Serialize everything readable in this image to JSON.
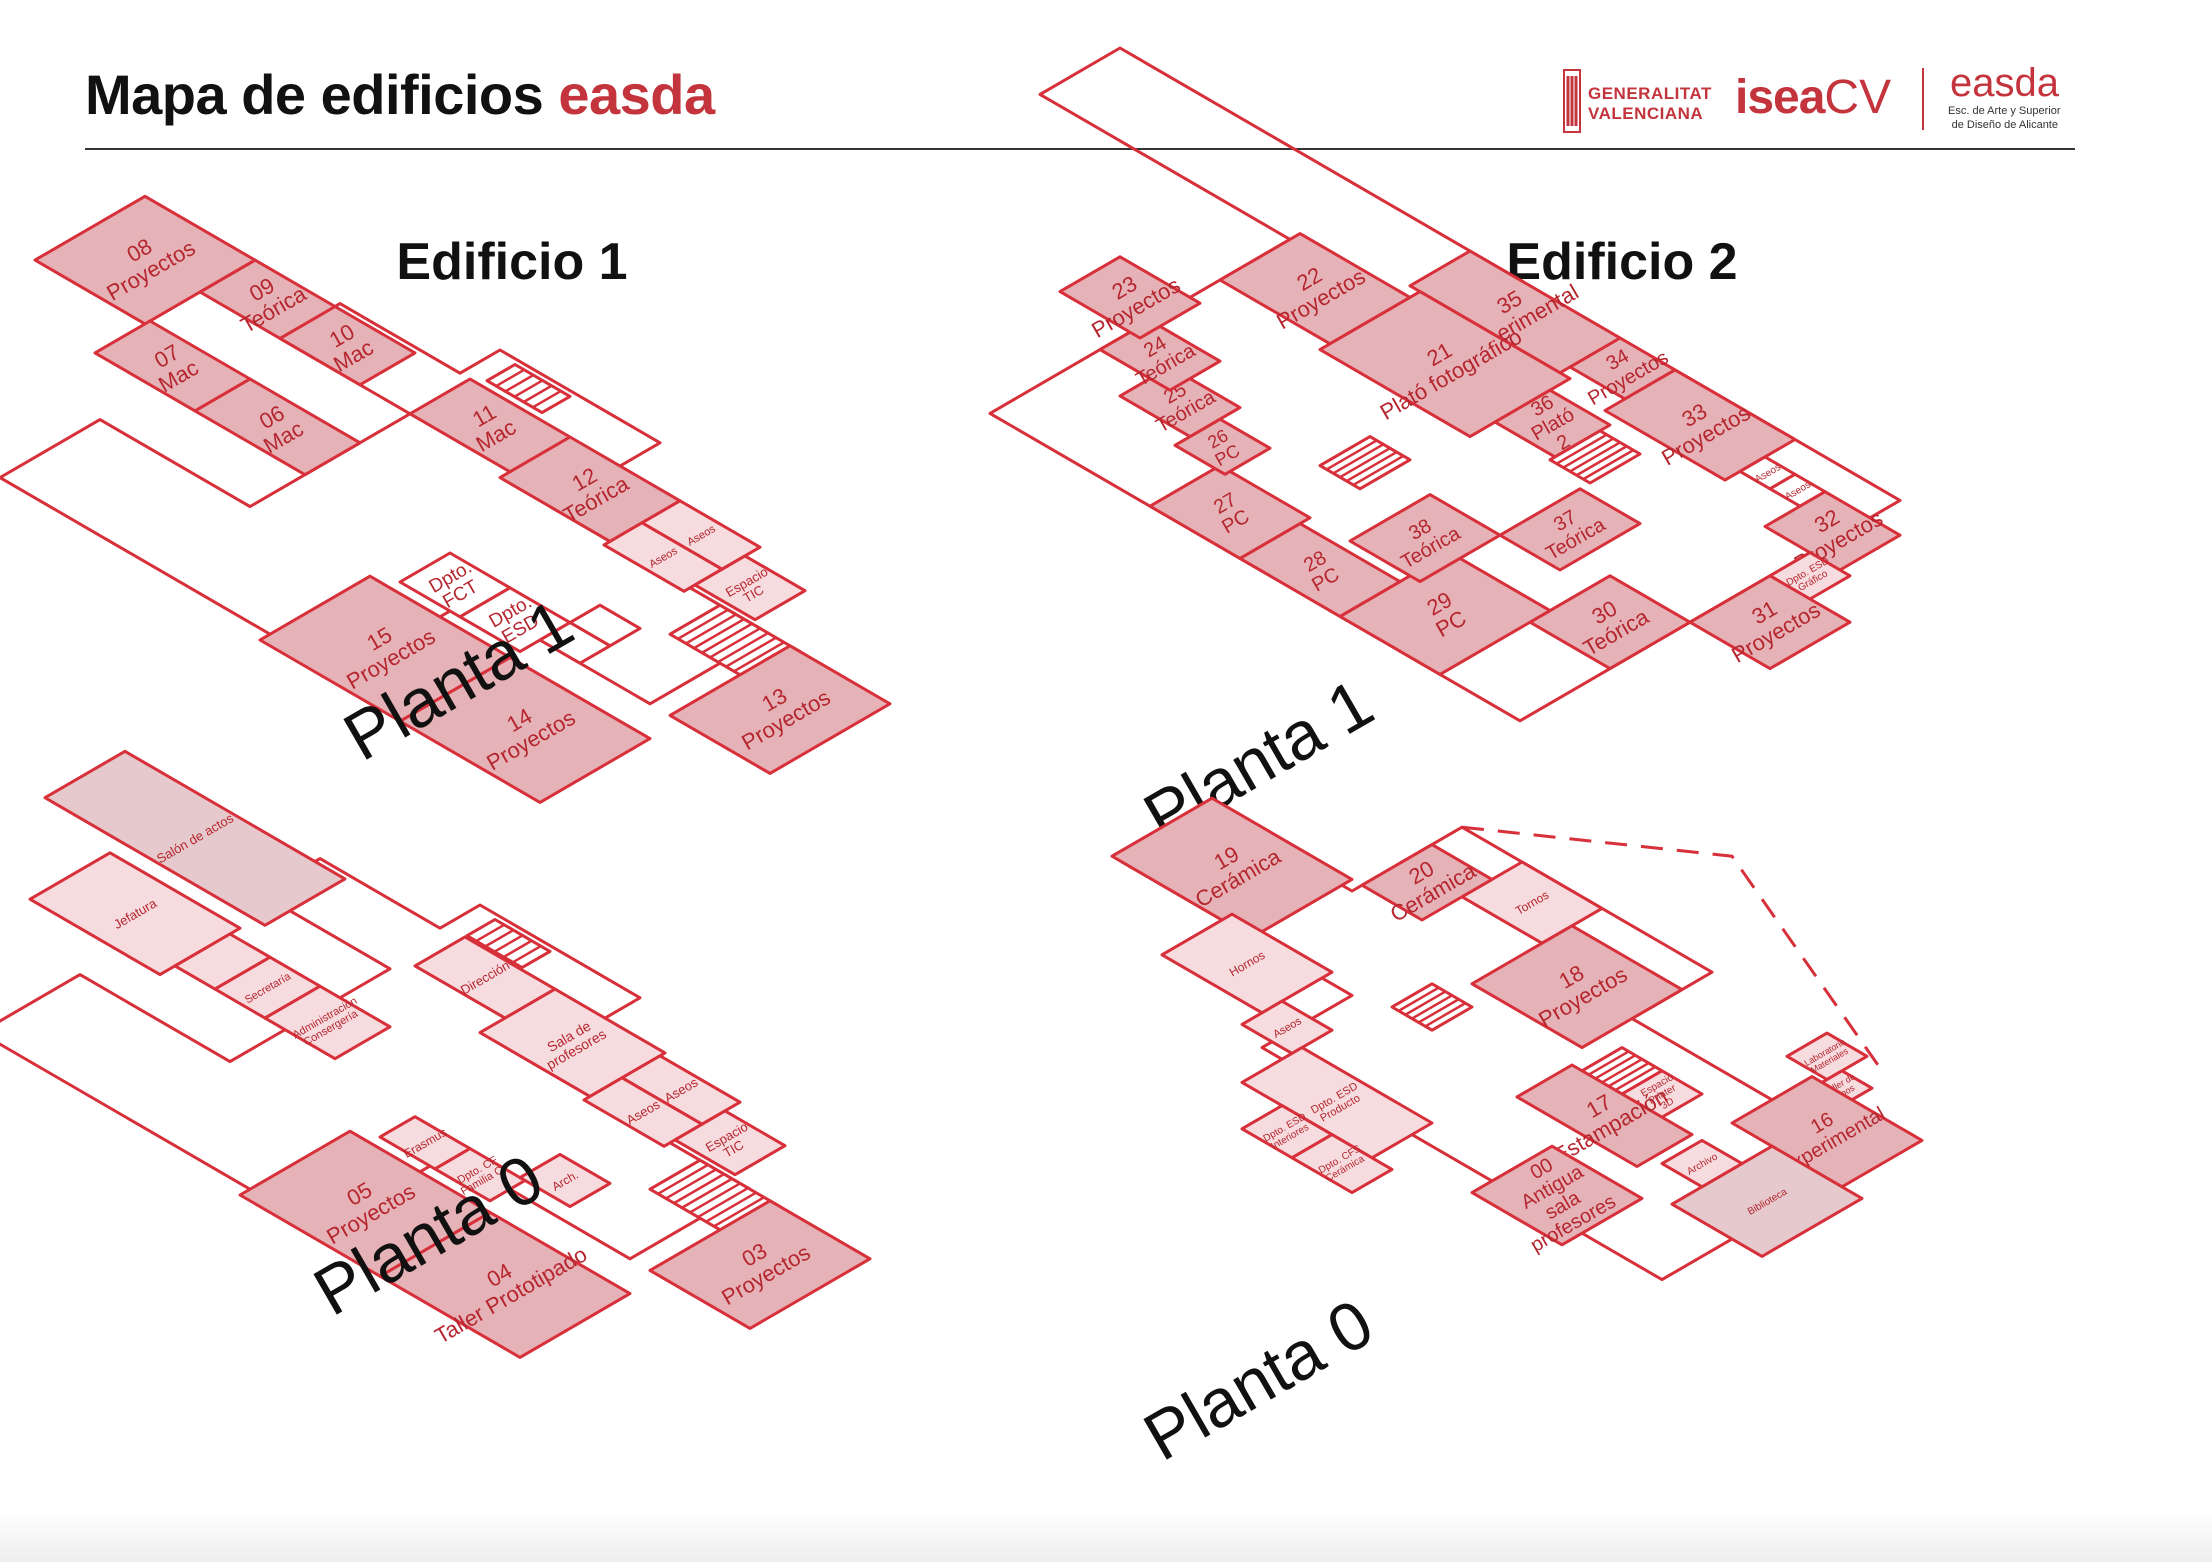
{
  "header": {
    "title_main": "Mapa de edificios",
    "title_accent": "easda",
    "logos": {
      "gv_line1": "GENERALITAT",
      "gv_line2": "VALENCIANA",
      "isea_bold": "isea",
      "isea_light": "CV",
      "easda_name": "easda",
      "easda_sub1": "Esc. de Arte y Superior",
      "easda_sub2": "de Diseño de Alicante"
    }
  },
  "colors": {
    "accent": "#c3343c",
    "room_dark": "#e5b3b7",
    "room_light": "#f7dcdf",
    "room_gray": "#e5c9cc",
    "stroke": "#d8303a"
  },
  "buildings": [
    {
      "title": "Edificio 1",
      "floors": [
        {
          "label": "Planta 1",
          "rooms": [
            {
              "id": "11",
              "lines": [
                "11",
                "Mac"
              ]
            },
            {
              "id": "12",
              "lines": [
                "12",
                "Teórica"
              ]
            },
            {
              "id": "aseos-a",
              "lines": [
                "Aseos"
              ]
            },
            {
              "id": "aseos-b",
              "lines": [
                "Aseos"
              ]
            },
            {
              "id": "tic",
              "lines": [
                "Espacio",
                "TIC"
              ]
            },
            {
              "id": "10",
              "lines": [
                "10",
                "Mac"
              ]
            },
            {
              "id": "09",
              "lines": [
                "09",
                "Teórica"
              ]
            },
            {
              "id": "08",
              "lines": [
                "08",
                "Proyectos"
              ]
            },
            {
              "id": "07",
              "lines": [
                "07",
                "Mac"
              ]
            },
            {
              "id": "06",
              "lines": [
                "06",
                "Mac"
              ]
            },
            {
              "id": "13",
              "lines": [
                "13",
                "Proyectos"
              ]
            },
            {
              "id": "14",
              "lines": [
                "14",
                "Proyectos"
              ]
            },
            {
              "id": "15",
              "lines": [
                "15",
                "Proyectos"
              ]
            },
            {
              "id": "fct",
              "lines": [
                "Dpto.",
                "FCT"
              ]
            },
            {
              "id": "esd",
              "lines": [
                "Dpto.",
                "ESD"
              ]
            }
          ]
        },
        {
          "label": "Planta 0",
          "rooms": [
            {
              "id": "direccion",
              "lines": [
                "Dirección"
              ]
            },
            {
              "id": "profes",
              "lines": [
                "Sala de",
                "profesores"
              ]
            },
            {
              "id": "aseos-a",
              "lines": [
                "Aseos"
              ]
            },
            {
              "id": "aseos-b",
              "lines": [
                "Aseos"
              ]
            },
            {
              "id": "tic",
              "lines": [
                "Espacio",
                "TIC"
              ]
            },
            {
              "id": "salon",
              "lines": [
                "Salón de actos"
              ]
            },
            {
              "id": "jefatura",
              "lines": [
                "Jefatura"
              ]
            },
            {
              "id": "secretaria",
              "lines": [
                "Secretaría"
              ]
            },
            {
              "id": "admin",
              "lines": [
                "Administración",
                "Consergería"
              ]
            },
            {
              "id": "03",
              "lines": [
                "03",
                "Proyectos"
              ]
            },
            {
              "id": "04",
              "lines": [
                "04",
                "Taller Prototipado"
              ]
            },
            {
              "id": "05",
              "lines": [
                "05",
                "Proyectos"
              ]
            },
            {
              "id": "erasmus",
              "lines": [
                "Erasmus"
              ]
            },
            {
              "id": "dpto-cf",
              "lines": [
                "Dpto. CF",
                "Familia C."
              ]
            },
            {
              "id": "arch",
              "lines": [
                "Arch."
              ]
            }
          ]
        }
      ]
    },
    {
      "title": "Edificio 2",
      "floors": [
        {
          "label": "Planta 1",
          "rooms": [
            {
              "id": "34",
              "lines": [
                "34",
                "Proyectos"
              ]
            },
            {
              "id": "35",
              "lines": [
                "35",
                "Experimental"
              ]
            },
            {
              "id": "33",
              "lines": [
                "33",
                "Proyectos"
              ]
            },
            {
              "id": "aseos-a",
              "lines": [
                "Aseos"
              ]
            },
            {
              "id": "aseos-b",
              "lines": [
                "Aseos"
              ]
            },
            {
              "id": "32",
              "lines": [
                "32",
                "Proyectos"
              ]
            },
            {
              "id": "dpto-grafico",
              "lines": [
                "Dpto. ESD",
                "Gráfico"
              ]
            },
            {
              "id": "31",
              "lines": [
                "31",
                "Proyectos"
              ]
            },
            {
              "id": "30",
              "lines": [
                "30",
                "Teórica"
              ]
            },
            {
              "id": "29",
              "lines": [
                "29",
                "PC"
              ]
            },
            {
              "id": "28",
              "lines": [
                "28",
                "PC"
              ]
            },
            {
              "id": "27",
              "lines": [
                "27",
                "PC"
              ]
            },
            {
              "id": "26",
              "lines": [
                "26",
                "PC"
              ]
            },
            {
              "id": "25",
              "lines": [
                "25",
                "Teórica"
              ]
            },
            {
              "id": "24",
              "lines": [
                "24",
                "Teórica"
              ]
            },
            {
              "id": "23",
              "lines": [
                "23",
                "Proyectos"
              ]
            },
            {
              "id": "22",
              "lines": [
                "22",
                "Proyectos"
              ]
            },
            {
              "id": "21",
              "lines": [
                "21",
                "Plató fotográfico"
              ]
            },
            {
              "id": "36",
              "lines": [
                "36",
                "Plató",
                "2"
              ]
            },
            {
              "id": "37",
              "lines": [
                "37",
                "Teórica"
              ]
            },
            {
              "id": "38",
              "lines": [
                "38",
                "Teórica"
              ]
            }
          ]
        },
        {
          "label": "Planta 0",
          "rooms": [
            {
              "id": "tornos",
              "lines": [
                "Tornos"
              ]
            },
            {
              "id": "20",
              "lines": [
                "20",
                "Cerámica"
              ]
            },
            {
              "id": "19",
              "lines": [
                "19",
                "Cerámica"
              ]
            },
            {
              "id": "18",
              "lines": [
                "18",
                "Proyectos"
              ]
            },
            {
              "id": "lab",
              "lines": [
                "Laboratorio",
                "Materiales"
              ]
            },
            {
              "id": "tipos",
              "lines": [
                "Taller de",
                "Tipos"
              ]
            },
            {
              "id": "16",
              "lines": [
                "16",
                "Experimental"
              ]
            },
            {
              "id": "biblioteca",
              "lines": [
                "Biblioteca"
              ]
            },
            {
              "id": "archivo",
              "lines": [
                "Archivo"
              ]
            },
            {
              "id": "printer",
              "lines": [
                "Espacio",
                "Printer",
                "3D"
              ]
            },
            {
              "id": "17",
              "lines": [
                "17",
                "Estampación"
              ]
            },
            {
              "id": "hornos",
              "lines": [
                "Hornos"
              ]
            },
            {
              "id": "aseos",
              "lines": [
                "Aseos"
              ]
            },
            {
              "id": "00",
              "lines": [
                "00",
                "Antigua",
                "sala",
                "profesores"
              ]
            },
            {
              "id": "dpto-producto",
              "lines": [
                "Dpto. ESD",
                "Producto"
              ]
            },
            {
              "id": "dpto-interiores",
              "lines": [
                "Dpto. ESD",
                "Interiores"
              ]
            },
            {
              "id": "dpto-ceramica",
              "lines": [
                "Dpto. CFS",
                "Cerámica"
              ]
            }
          ]
        }
      ]
    }
  ]
}
